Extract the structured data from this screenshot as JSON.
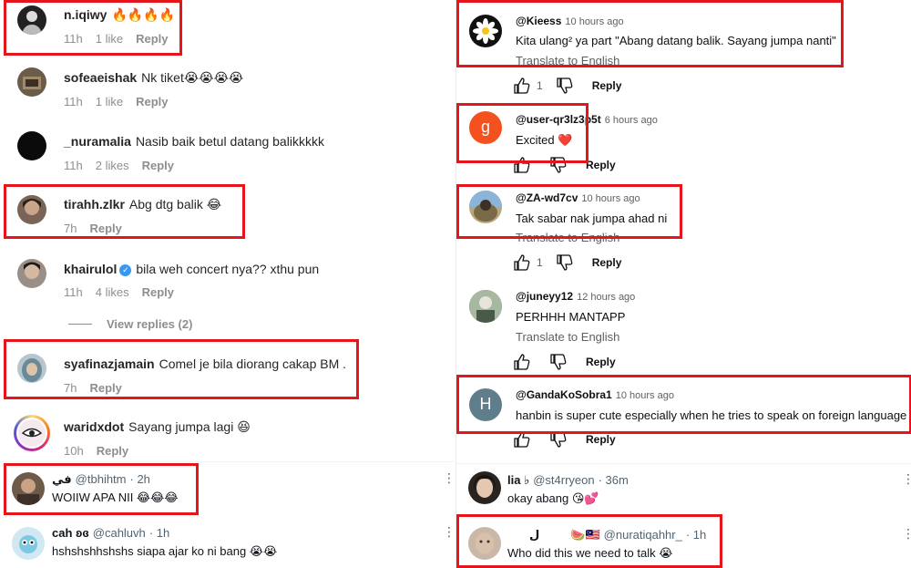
{
  "instagram": {
    "comments": [
      {
        "username": "n.iqiwy",
        "text": "🔥🔥🔥🔥",
        "time": "11h",
        "likes": "1 like",
        "reply": "Reply"
      },
      {
        "username": "sofeaeishak",
        "text": "Nk tiket😭😭😭😭",
        "time": "11h",
        "likes": "1 like",
        "reply": "Reply"
      },
      {
        "username": "_nuramalia",
        "text": "Nasib baik betul datang balikkkkk",
        "time": "11h",
        "likes": "2 likes",
        "reply": "Reply"
      },
      {
        "username": "tirahh.zlkr",
        "text": "Abg dtg balik 😂",
        "time": "7h",
        "reply": "Reply"
      },
      {
        "username": "khairulol",
        "text": "bila weh concert nya?? xthu pun",
        "time": "11h",
        "likes": "4 likes",
        "reply": "Reply",
        "view_replies": "View replies (2)"
      },
      {
        "username": "syafinazjamain",
        "text": "Comel je bila diorang cakap BM .",
        "time": "7h",
        "reply": "Reply"
      },
      {
        "username": "waridxdot",
        "text": "Sayang jumpa lagi 😆",
        "time": "10h",
        "reply": "Reply"
      }
    ]
  },
  "twitter_left": [
    {
      "name": "في",
      "handle": "@tbhihtm",
      "time": "· 2h",
      "text": "WOIIW APA NII 😂😂😂",
      "more": "⋮"
    },
    {
      "name": "cah ʚɞ",
      "handle": "@cahluvh",
      "time": "· 1h",
      "text": "hshshshhshshs siapa ajar ko ni bang 😭😭",
      "more": "⋮"
    }
  ],
  "youtube": {
    "translate_label": "Translate to English",
    "reply_label": "Reply",
    "comments": [
      {
        "avatar_letter": "",
        "username": "@Kieess",
        "time": "10 hours ago",
        "text": "Kita ulang² ya part \"Abang datang balik. Sayang jumpa nanti\"",
        "translate": true,
        "likes": "1",
        "avatar_color": "#111111"
      },
      {
        "avatar_letter": "g",
        "username": "@user-qr3lz3p5t",
        "time": "6 hours ago",
        "text": "Excited ❤️",
        "translate": false,
        "likes": "",
        "avatar_color": "#f4511e"
      },
      {
        "avatar_letter": "",
        "username": "@ZA-wd7cv",
        "time": "10 hours ago",
        "text": "Tak sabar nak jumpa ahad ni",
        "translate": true,
        "likes": "1",
        "avatar_color": "#8a7a5a"
      },
      {
        "avatar_letter": "",
        "username": "@juneyy12",
        "time": "12 hours ago",
        "text": "PERHHH MANTAPP",
        "translate": true,
        "likes": "",
        "avatar_color": "#6b7a6b"
      },
      {
        "avatar_letter": "H",
        "username": "@GandaKoSobra1",
        "time": "10 hours ago",
        "text": "hanbin is super cute especially when he tries to speak on foreign language",
        "translate": false,
        "likes": "",
        "avatar_color": "#607d8b"
      }
    ]
  },
  "twitter_right": [
    {
      "name": "lia ♭",
      "handle": "@st4rryeon",
      "time": "· 36m",
      "text": "okay abang 😘💕",
      "more": "⋮"
    },
    {
      "name": "ل",
      "flags": "🍉🇲🇾",
      "handle": "@nuratiqahhr_",
      "time": "· 1h",
      "text": "Who did this we need to talk 😭",
      "more": "⋮"
    }
  ],
  "colors": {
    "highlight": "#e4161b",
    "ig_meta": "#8e8e8e",
    "yt_secondary": "#606060",
    "verified": "#3897f0"
  }
}
